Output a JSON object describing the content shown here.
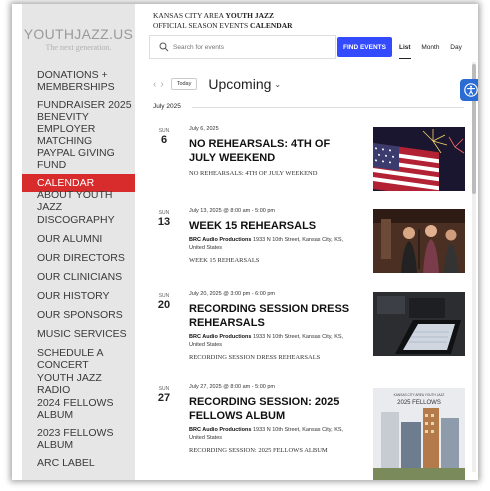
{
  "logo": {
    "title": "YOUTHJAZZ.US",
    "subtitle": "The next generation."
  },
  "nav": [
    {
      "label": "DONATIONS + MEMBERSHIPS",
      "active": false
    },
    {
      "label": "FUNDRAISER 2025",
      "active": false
    },
    {
      "label": "BENEVITY EMPLOYER MATCHING",
      "active": false
    },
    {
      "label": "PAYPAL GIVING FUND",
      "active": false
    },
    {
      "label": "CALENDAR",
      "active": true
    },
    {
      "label": "ABOUT YOUTH JAZZ",
      "active": false
    },
    {
      "label": "DISCOGRAPHY",
      "active": false
    },
    {
      "label": "OUR ALUMNI",
      "active": false
    },
    {
      "label": "OUR DIRECTORS",
      "active": false
    },
    {
      "label": "OUR CLINICIANS",
      "active": false
    },
    {
      "label": "OUR HISTORY",
      "active": false
    },
    {
      "label": "OUR SPONSORS",
      "active": false
    },
    {
      "label": "MUSIC SERVICES",
      "active": false
    },
    {
      "label": "SCHEDULE A CONCERT",
      "active": false
    },
    {
      "label": "YOUTH JAZZ RADIO",
      "active": false
    },
    {
      "label": "2024 FELLOWS ALBUM",
      "active": false
    },
    {
      "label": "2023 FELLOWS ALBUM",
      "active": false
    },
    {
      "label": "ARC LABEL",
      "active": false
    }
  ],
  "header": {
    "line1_prefix": "KANSAS CITY AREA ",
    "line1_bold": "YOUTH JAZZ",
    "line2_prefix": "OFFICIAL SEASON EVENTS ",
    "line2_bold": "CALENDAR"
  },
  "search": {
    "placeholder": "Search for events",
    "button_label": "FIND EVENTS"
  },
  "views": {
    "list": "List",
    "month": "Month",
    "day": "Day",
    "selected": "List"
  },
  "toolbar": {
    "today_label": "Today",
    "heading": "Upcoming"
  },
  "month_label": "July 2025",
  "events": [
    {
      "dow": "SUN",
      "day": "6",
      "when": "July 6, 2025",
      "title": "NO REHEARSALS: 4TH OF JULY WEEKEND",
      "venue_name": "",
      "venue_address": "",
      "description": "NO REHEARSALS: 4TH OF JULY WEEKEND",
      "image": "fireworks-flag"
    },
    {
      "dow": "SUN",
      "day": "13",
      "when": "July 13, 2025 @ 8:00 am - 5:00 pm",
      "title": "WEEK 15 REHEARSALS",
      "venue_name": "BRC Audio Productions",
      "venue_address": "1933 N 10th Street, Kansas City, KS, United States",
      "description": "WEEK 15 REHEARSALS",
      "image": "studio-singers"
    },
    {
      "dow": "SUN",
      "day": "20",
      "when": "July 20, 2025 @ 3:00 pm - 6:00 pm",
      "title": "RECORDING SESSION DRESS REHEARSALS",
      "venue_name": "BRC Audio Productions",
      "venue_address": "1933 N 10th Street, Kansas City, KS, United States",
      "description": "RECORDING SESSION DRESS REHEARSALS",
      "image": "studio-laptop"
    },
    {
      "dow": "SUN",
      "day": "27",
      "when": "July 27, 2025 @ 8:00 am - 5:00 pm",
      "title": "RECORDING SESSION: 2025 FELLOWS ALBUM",
      "venue_name": "BRC Audio Productions",
      "venue_address": "1933 N 10th Street, Kansas City, KS, United States",
      "description": "RECORDING SESSION: 2025 FELLOWS ALBUM",
      "image": "album-cover",
      "image_text": "2025 FELLOWS",
      "image_smalltext": "KANSAS CITY AREA YOUTH JAZZ"
    }
  ],
  "colors": {
    "accent": "#d82c2c",
    "button": "#334aff",
    "sidebar": "#e6e6e6"
  }
}
